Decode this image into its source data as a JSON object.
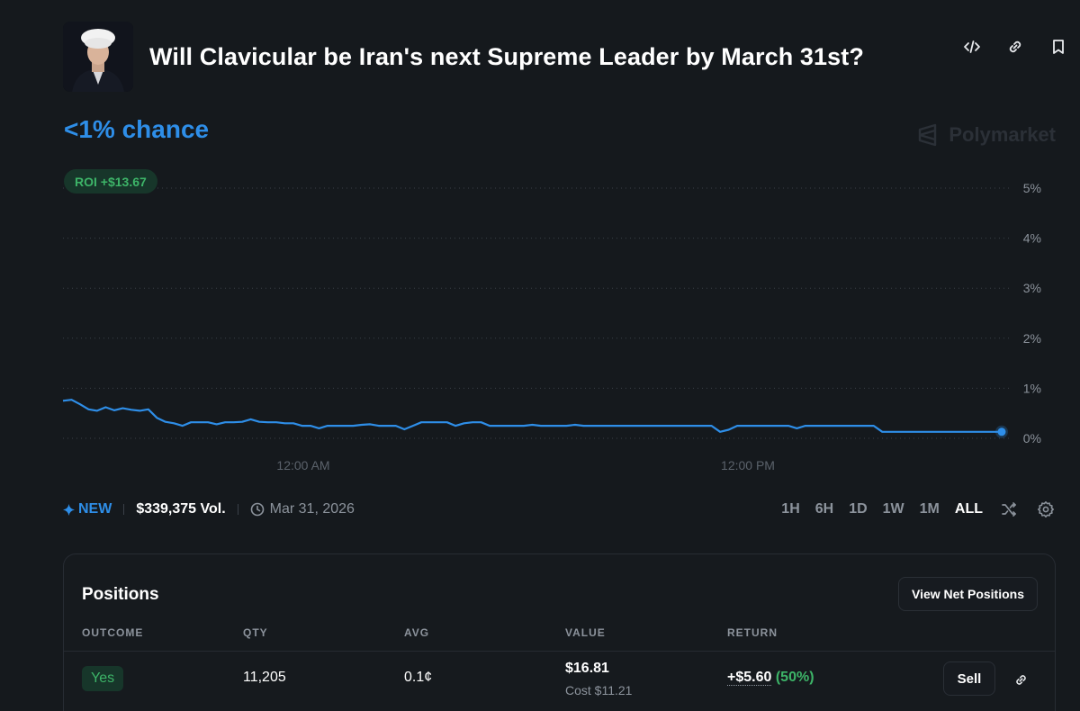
{
  "market": {
    "title": "Will Clavicular be Iran's next Supreme Leader by March 31st?",
    "chance": "<1% chance",
    "brand": "Polymarket",
    "roi": "ROI +$13.67"
  },
  "header_icons": [
    "code-embed-icon",
    "link-icon",
    "bookmark-icon"
  ],
  "meta": {
    "badge": "NEW",
    "volume": "$339,375 Vol.",
    "end_date": "Mar 31, 2026"
  },
  "ranges": {
    "options": [
      "1H",
      "6H",
      "1D",
      "1W",
      "1M",
      "ALL"
    ],
    "active": "ALL"
  },
  "chart_data": {
    "type": "line",
    "y_ticks": [
      "5%",
      "4%",
      "3%",
      "2%",
      "1%",
      "0%"
    ],
    "x_ticks": [
      "12:00 AM",
      "12:00 PM"
    ],
    "ylim": [
      0,
      5
    ],
    "grid": true,
    "color": "#2e8ee8",
    "series": [
      {
        "values": [
          0.75,
          0.77,
          0.68,
          0.58,
          0.55,
          0.62,
          0.56,
          0.6,
          0.57,
          0.55,
          0.58,
          0.41,
          0.33,
          0.3,
          0.25,
          0.32,
          0.32,
          0.32,
          0.28,
          0.32,
          0.32,
          0.33,
          0.38,
          0.33,
          0.32,
          0.32,
          0.3,
          0.3,
          0.25,
          0.25,
          0.2,
          0.25,
          0.25,
          0.25,
          0.25,
          0.27,
          0.28,
          0.25,
          0.25,
          0.25,
          0.18,
          0.25,
          0.32,
          0.32,
          0.32,
          0.32,
          0.25,
          0.3,
          0.32,
          0.32,
          0.25,
          0.25,
          0.25,
          0.25,
          0.25,
          0.27,
          0.25,
          0.25,
          0.25,
          0.25,
          0.27,
          0.25,
          0.25,
          0.25,
          0.25,
          0.25,
          0.25,
          0.25,
          0.25,
          0.25,
          0.25,
          0.25,
          0.25,
          0.25,
          0.25,
          0.25,
          0.25,
          0.13,
          0.17,
          0.25,
          0.25,
          0.25,
          0.25,
          0.25,
          0.25,
          0.25,
          0.2,
          0.25,
          0.25,
          0.25,
          0.25,
          0.25,
          0.25,
          0.25,
          0.25,
          0.25,
          0.13,
          0.13,
          0.13,
          0.13,
          0.13,
          0.13,
          0.13,
          0.13,
          0.13,
          0.13,
          0.13,
          0.13,
          0.13,
          0.13,
          0.13
        ]
      }
    ]
  },
  "positions": {
    "title": "Positions",
    "view_net": "View Net Positions",
    "columns": [
      "OUTCOME",
      "QTY",
      "AVG",
      "VALUE",
      "RETURN"
    ],
    "rows": [
      {
        "outcome": "Yes",
        "qty": "11,205",
        "avg": "0.1¢",
        "value": "$16.81",
        "cost": "Cost $11.21",
        "return_amt": "+$5.60",
        "return_pct": "(50%)",
        "action": "Sell"
      }
    ]
  }
}
